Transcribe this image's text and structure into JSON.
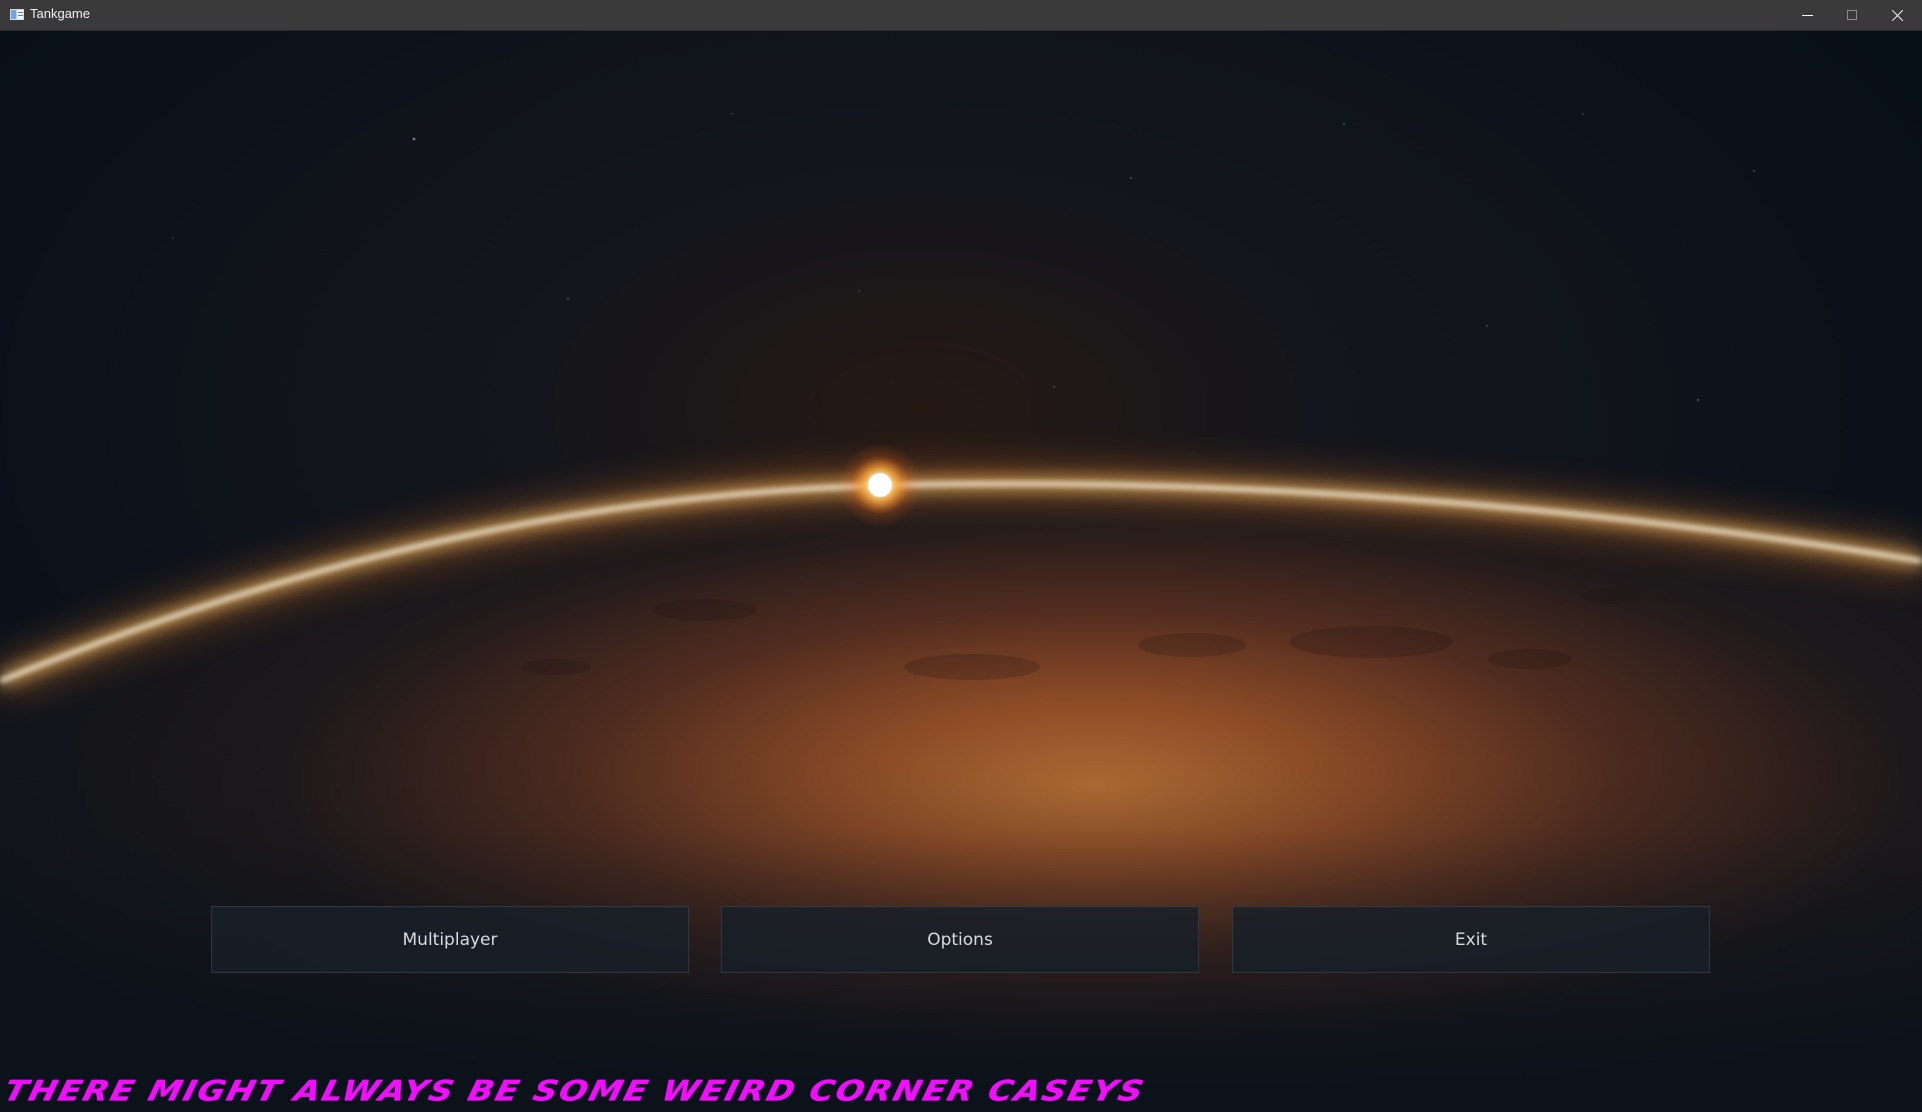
{
  "window": {
    "title": "Tankgame",
    "controls": {
      "minimize": "minimize-icon",
      "maximize": "maximize-icon",
      "close": "close-icon"
    }
  },
  "menu": {
    "buttons": [
      {
        "label": "Multiplayer"
      },
      {
        "label": "Options"
      },
      {
        "label": "Exit"
      }
    ]
  },
  "banner": {
    "text": "There might always be some weird corner caseys",
    "color": "#f20dff"
  },
  "colors": {
    "background": "#0b121a",
    "planet_light": "#ffb14a",
    "planet_dark": "#241814"
  },
  "icons": {
    "app": "app-window-icon"
  }
}
